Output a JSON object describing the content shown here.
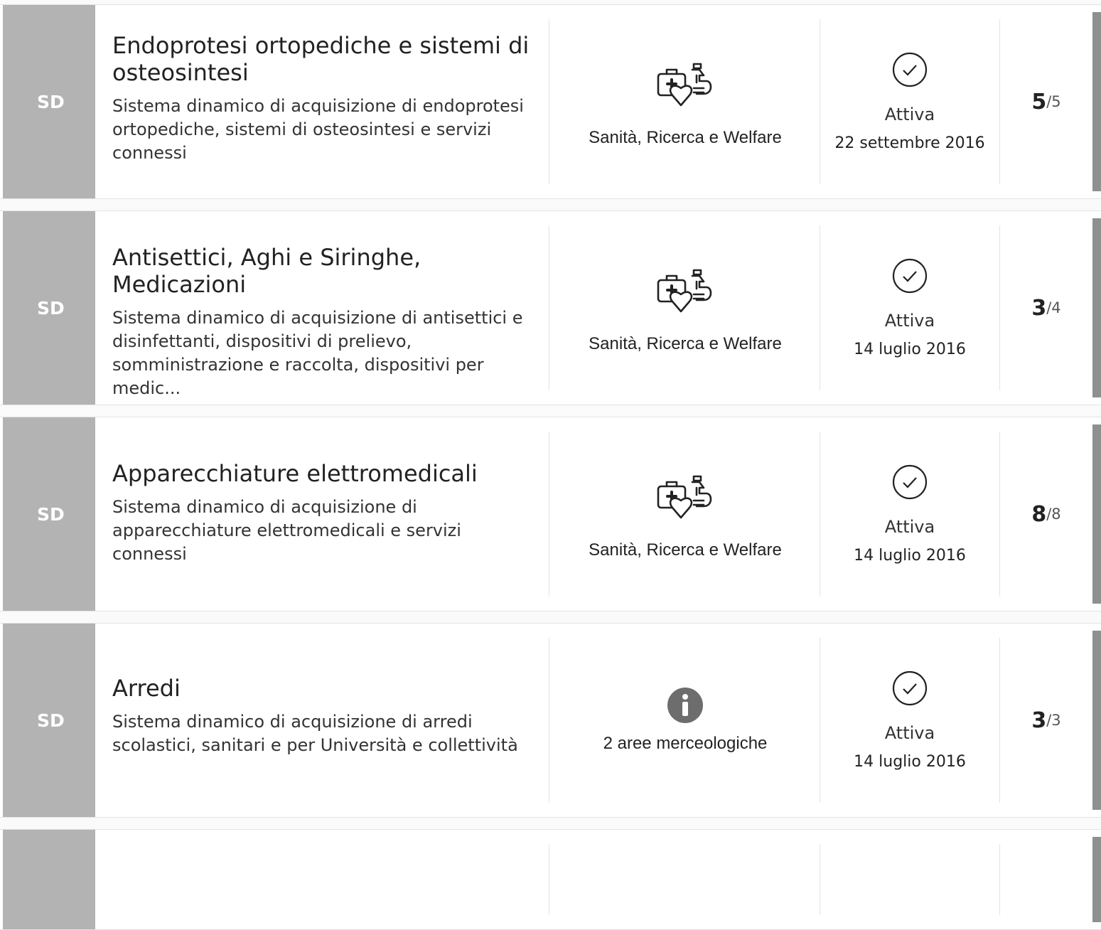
{
  "rows": [
    {
      "badge": "SD",
      "title": "Endoprotesi ortopediche e sistemi di osteosintesi",
      "description": "Sistema dinamico di acquisizione di endoprotesi ortopediche, sistemi di osteosintesi e servizi connessi",
      "category": "Sanità, Ricerca e Welfare",
      "category_icon": "health-research-welfare-icon",
      "status": "Attiva",
      "date": "22 settembre 2016",
      "count_active": "5",
      "count_total": "/5"
    },
    {
      "badge": "SD",
      "title": "Antisettici, Aghi e Siringhe, Medicazioni",
      "description": "Sistema dinamico di acquisizione di antisettici e disinfettanti, dispositivi di prelievo, somministrazione e raccolta, dispositivi per medic...",
      "category": "Sanità, Ricerca e Welfare",
      "category_icon": "health-research-welfare-icon",
      "status": "Attiva",
      "date": "14 luglio 2016",
      "count_active": "3",
      "count_total": "/4"
    },
    {
      "badge": "SD",
      "title": "Apparecchiature elettromedicali",
      "description": "Sistema dinamico di acquisizione di apparecchiature elettromedicali e servizi connessi",
      "category": "Sanità, Ricerca e Welfare",
      "category_icon": "health-research-welfare-icon",
      "status": "Attiva",
      "date": "14 luglio 2016",
      "count_active": "8",
      "count_total": "/8"
    },
    {
      "badge": "SD",
      "title": "Arredi",
      "description": "Sistema dinamico di acquisizione di arredi scolastici, sanitari e per Università e collettività",
      "category": "2 aree merceologiche",
      "category_icon": "info-icon",
      "status": "Attiva",
      "date": "14 luglio 2016",
      "count_active": "3",
      "count_total": "/3"
    }
  ],
  "colors": {
    "badge_bg": "#b3b3b3",
    "accent_bar": "#8f8f8f",
    "text": "#222222"
  }
}
